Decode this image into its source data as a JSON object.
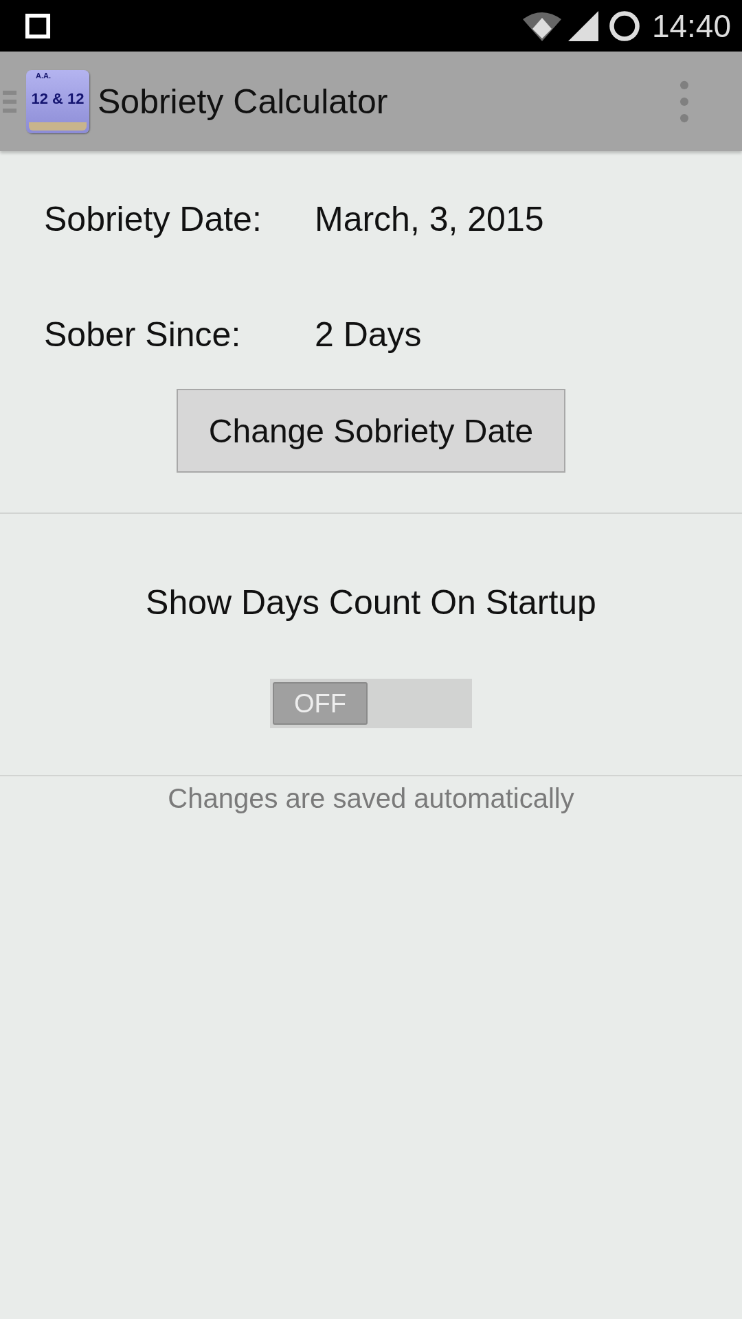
{
  "status_bar": {
    "time": "14:40"
  },
  "toolbar": {
    "title": "Sobriety Calculator",
    "app_icon": {
      "corner_text": "A.A.",
      "title_text": "12 & 12"
    }
  },
  "fields": [
    {
      "label": "Sobriety Date:",
      "value": "March, 3, 2015"
    },
    {
      "label": "Sober Since:",
      "value": "2 Days"
    }
  ],
  "change_button": "Change Sobriety Date",
  "startup_setting": {
    "label": "Show Days Count On Startup",
    "toggle": {
      "on": false,
      "text": "OFF"
    }
  },
  "footer_note": "Changes are saved automatically"
}
